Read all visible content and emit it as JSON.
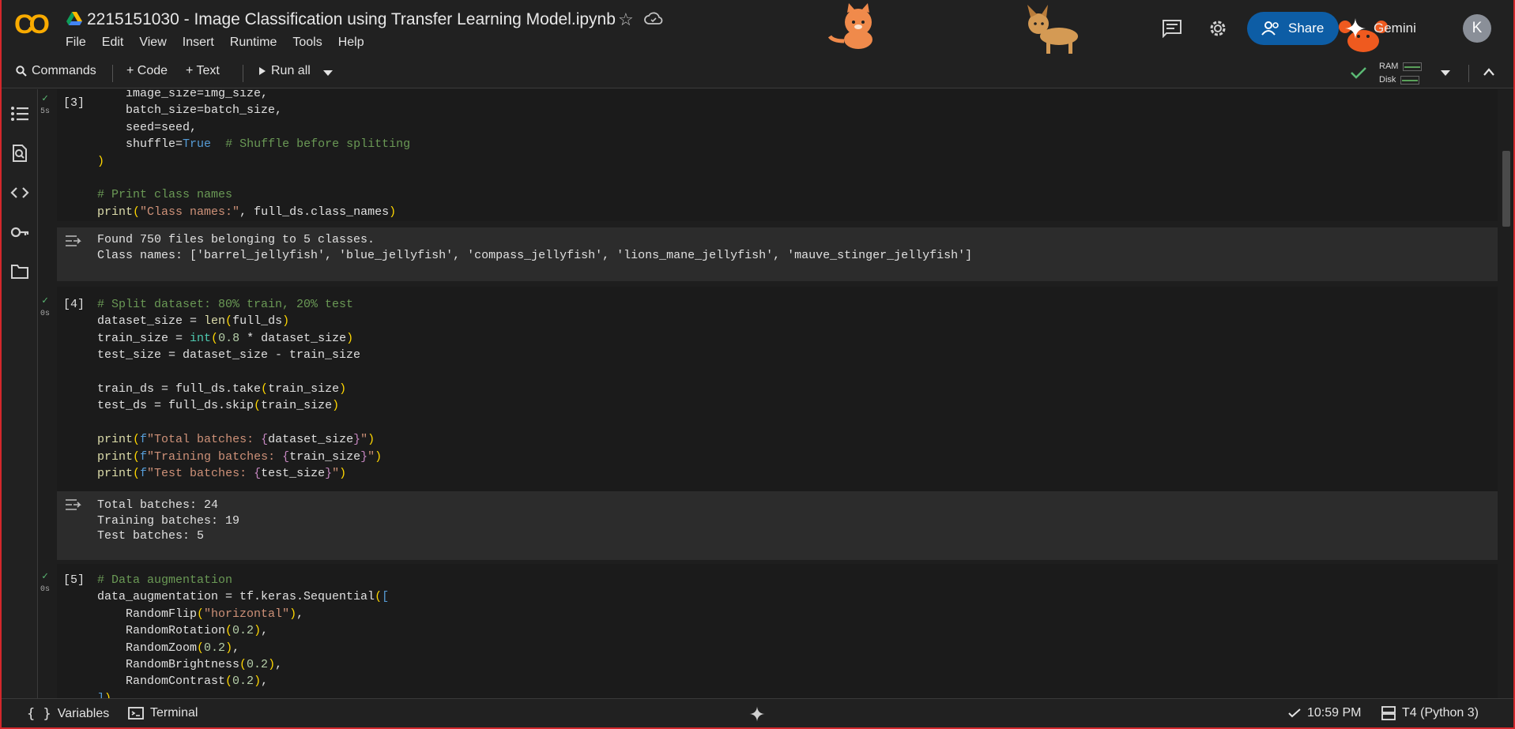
{
  "header": {
    "title": "2215151030 - Image Classification using Transfer Learning Model.ipynb",
    "logo_text": "CO",
    "menu": [
      "File",
      "Edit",
      "View",
      "Insert",
      "Runtime",
      "Tools",
      "Help"
    ],
    "share_label": "Share",
    "gemini_label": "Gemini",
    "avatar_initial": "K"
  },
  "toolbar": {
    "commands_label": "Commands",
    "code_label": "+ Code",
    "text_label": "+ Text",
    "run_all_label": "Run all",
    "ram_label": "RAM",
    "disk_label": "Disk"
  },
  "cells": [
    {
      "exec_count": "[3]",
      "run_time": "5s",
      "code": [
        "    image_size=img_size,",
        "    batch_size=batch_size,",
        "    seed=seed,",
        "    shuffle=True  # Shuffle before splitting",
        ")",
        "",
        "# Print class names",
        "print(\"Class names:\", full_ds.class_names)"
      ],
      "output": [
        "Found 750 files belonging to 5 classes.",
        "Class names: ['barrel_jellyfish', 'blue_jellyfish', 'compass_jellyfish', 'lions_mane_jellyfish', 'mauve_stinger_jellyfish']"
      ]
    },
    {
      "exec_count": "[4]",
      "run_time": "0s",
      "code": [
        "# Split dataset: 80% train, 20% test",
        "dataset_size = len(full_ds)",
        "train_size = int(0.8 * dataset_size)",
        "test_size = dataset_size - train_size",
        "",
        "train_ds = full_ds.take(train_size)",
        "test_ds = full_ds.skip(train_size)",
        "",
        "print(f\"Total batches: {dataset_size}\")",
        "print(f\"Training batches: {train_size}\")",
        "print(f\"Test batches: {test_size}\")"
      ],
      "output": [
        "Total batches: 24",
        "Training batches: 19",
        "Test batches: 5"
      ]
    },
    {
      "exec_count": "[5]",
      "run_time": "0s",
      "code": [
        "# Data augmentation",
        "data_augmentation = tf.keras.Sequential([",
        "    RandomFlip(\"horizontal\"),",
        "    RandomRotation(0.2),",
        "    RandomZoom(0.2),",
        "    RandomBrightness(0.2),",
        "    RandomContrast(0.2),",
        "])"
      ]
    }
  ],
  "statusbar": {
    "variables_label": "Variables",
    "terminal_label": "Terminal",
    "time": "10:59 PM",
    "runtime": "T4 (Python 3)"
  },
  "colors": {
    "background": "#1e1e1e",
    "share_button": "#0d5da5",
    "logo_orange": "#f9ab00",
    "frame_red": "#d3272b",
    "success_green": "#5bb974"
  }
}
